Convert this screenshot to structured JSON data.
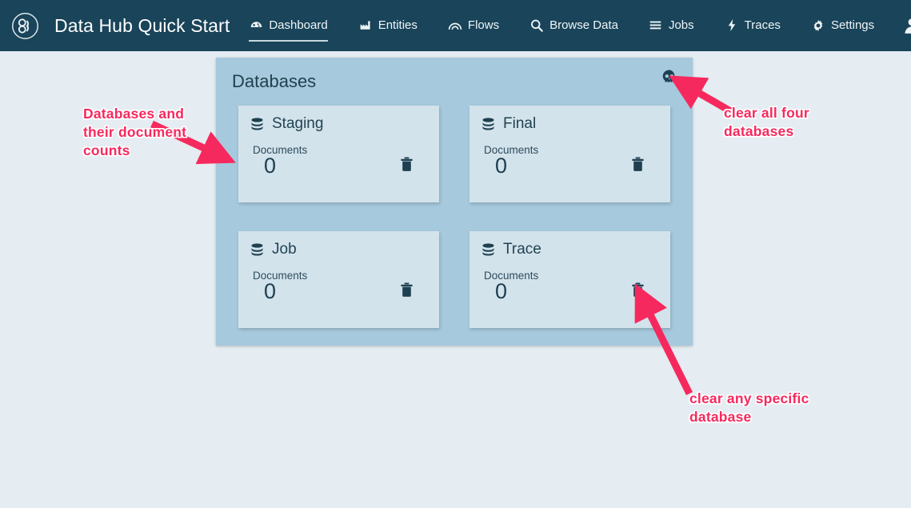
{
  "navbar": {
    "logo_icon": "marklogic-logo-icon",
    "brand": "Data Hub Quick Start",
    "avatar_icon": "user-avatar-icon",
    "items": [
      {
        "label": "Dashboard",
        "icon": "dashboard-icon",
        "active": true
      },
      {
        "label": "Entities",
        "icon": "entities-icon",
        "active": false
      },
      {
        "label": "Flows",
        "icon": "flows-icon",
        "active": false
      },
      {
        "label": "Browse Data",
        "icon": "search-icon",
        "active": false
      },
      {
        "label": "Jobs",
        "icon": "jobs-list-icon",
        "active": false
      },
      {
        "label": "Traces",
        "icon": "traces-bolt-icon",
        "active": false
      },
      {
        "label": "Settings",
        "icon": "gear-icon",
        "active": false
      }
    ]
  },
  "panel": {
    "title": "Databases",
    "clear_all_icon": "skull-icon",
    "documents_label": "Documents",
    "delete_icon": "trash-icon",
    "database_icon": "database-stack-icon",
    "cards": [
      {
        "name": "Staging",
        "documents_label": "Documents",
        "count": "0"
      },
      {
        "name": "Final",
        "documents_label": "Documents",
        "count": "0"
      },
      {
        "name": "Job",
        "documents_label": "Documents",
        "count": "0"
      },
      {
        "name": "Trace",
        "documents_label": "Documents",
        "count": "0"
      }
    ]
  },
  "annotations": {
    "left": "Databases and their document counts",
    "right": "clear all four databases",
    "bottom": "clear any specific database",
    "color": "#f6295e"
  },
  "colors": {
    "navbar": "#194459",
    "page_background": "#e5ecf2",
    "panel_background": "#a6c9dd",
    "card_background": "#d3e3ec",
    "text_dark": "#224352",
    "annotation": "#f6295e"
  }
}
